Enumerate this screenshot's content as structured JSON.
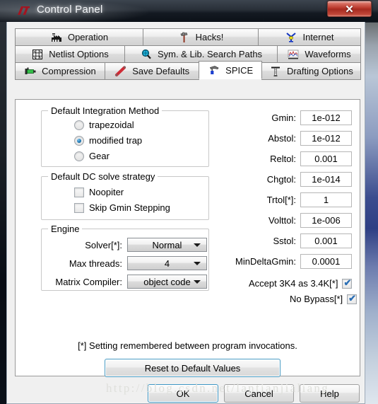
{
  "window": {
    "title": "Control Panel",
    "logo_icon": "lt-logo-icon",
    "close_label": "✕",
    "close_icon": "close-icon"
  },
  "tabs": {
    "rows": [
      [
        {
          "label": "Operation",
          "icon": "factory-icon",
          "active": false
        },
        {
          "label": "Hacks!",
          "icon": "hammer-icon",
          "active": false
        },
        {
          "label": "Internet",
          "icon": "antenna-icon",
          "active": false
        }
      ],
      [
        {
          "label": "Netlist Options",
          "icon": "grid-icon",
          "active": false
        },
        {
          "label": "Sym. & Lib. Search Paths",
          "icon": "magnifier-icon",
          "active": false
        },
        {
          "label": "Waveforms",
          "icon": "waveform-icon",
          "active": false
        }
      ],
      [
        {
          "label": "Compression",
          "icon": "clamp-icon",
          "active": false
        },
        {
          "label": "Save Defaults",
          "icon": "rolling-pin-icon",
          "active": false
        },
        {
          "label": "SPICE",
          "icon": "spray-icon",
          "active": true
        },
        {
          "label": "Drafting Options",
          "icon": "ruler-icon",
          "active": false
        }
      ]
    ]
  },
  "integration_method": {
    "title": "Default Integration Method",
    "options": [
      {
        "label": "trapezoidal",
        "checked": false
      },
      {
        "label": "modified trap",
        "checked": true
      },
      {
        "label": "Gear",
        "checked": false
      }
    ]
  },
  "dc_solve": {
    "title": "Default DC solve strategy",
    "options": [
      {
        "label": "Noopiter",
        "checked": false
      },
      {
        "label": "Skip Gmin Stepping",
        "checked": false
      }
    ]
  },
  "engine": {
    "title": "Engine",
    "rows": [
      {
        "label": "Solver[*]:",
        "value": "Normal"
      },
      {
        "label": "Max threads:",
        "value": "4"
      },
      {
        "label": "Matrix Compiler:",
        "value": "object code"
      }
    ]
  },
  "parameters": [
    {
      "label": "Gmin:",
      "value": "1e-012"
    },
    {
      "label": "Abstol:",
      "value": "1e-012"
    },
    {
      "label": "Reltol:",
      "value": "0.001"
    },
    {
      "label": "Chgtol:",
      "value": "1e-014"
    },
    {
      "label": "Trtol[*]:",
      "value": "1"
    },
    {
      "label": "Volttol:",
      "value": "1e-006"
    },
    {
      "label": "Sstol:",
      "value": "0.001"
    },
    {
      "label": "MinDeltaGmin:",
      "value": "0.0001"
    }
  ],
  "param_checks": [
    {
      "label": "Accept 3K4 as 3.4K[*]",
      "checked": true
    },
    {
      "label": "No Bypass[*]",
      "checked": true
    }
  ],
  "footnote": "[*] Setting remembered between program invocations.",
  "reset_button": "Reset to Default Values",
  "buttons": {
    "ok": "OK",
    "cancel": "Cancel",
    "help": "Help"
  },
  "watermark": "http://blog.csdn.net/lantianjialiang",
  "colors": {
    "accent": "#2b6fb5",
    "close_red": "#b53226",
    "panel_bg": "#f0f0f0",
    "content_bg": "#ffffff"
  }
}
